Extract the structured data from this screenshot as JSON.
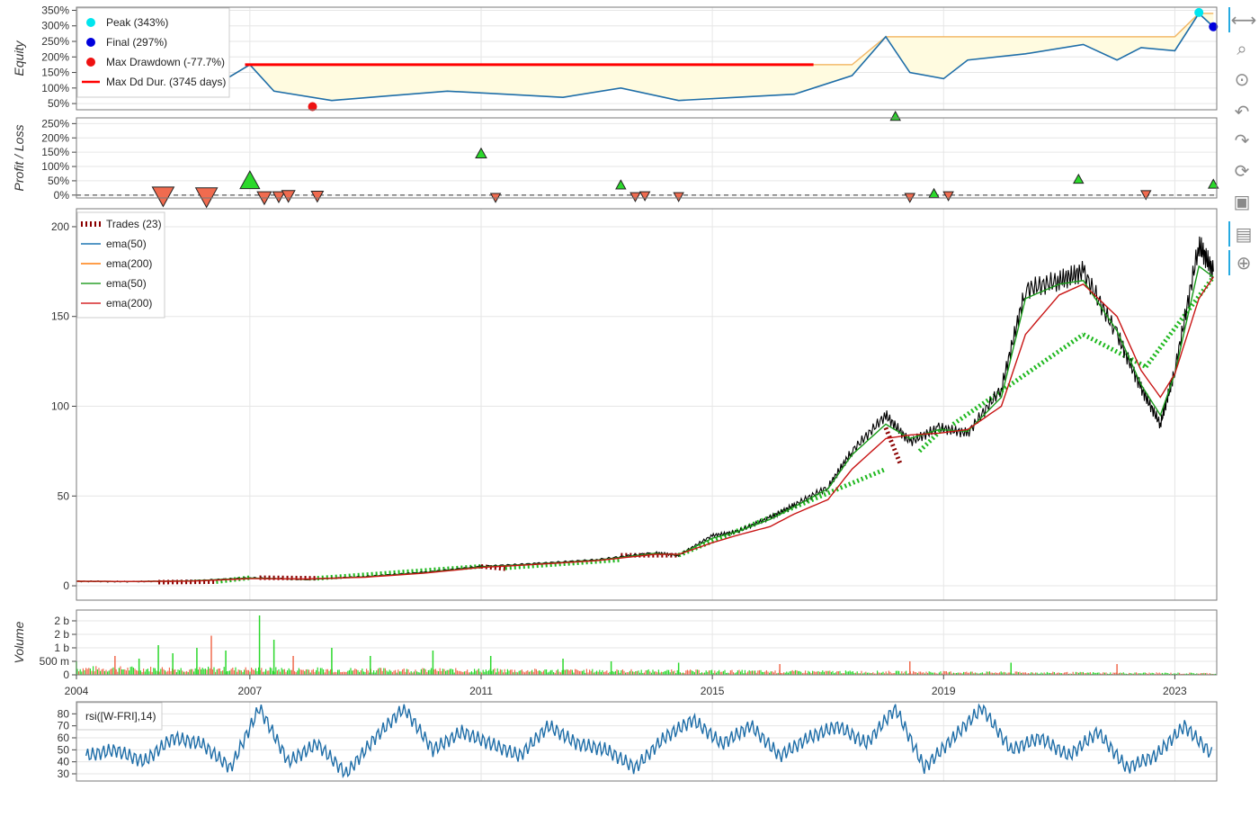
{
  "colors": {
    "equity_line": "#1f6ea8",
    "drawdown_fill": "#fffbe0",
    "peak_line": "#f2b96a",
    "max_dd_line": "#ff0000",
    "peak_marker": "#00e5ee",
    "final_marker": "#0000dd",
    "dd_marker": "#ee1111",
    "win": "#2bd82b",
    "loss": "#f06b4f",
    "price": "#000000",
    "ema50_main": "#1a9a1a",
    "ema200_main": "#c81414",
    "trades_loss": "#8b0000",
    "rsi": "#1f6ea8",
    "grid": "#e6e6e6"
  },
  "chart_data": [
    {
      "type": "line",
      "panel": "equity",
      "ylabel": "Equity",
      "y_ticks": [
        "50%",
        "100%",
        "150%",
        "200%",
        "250%",
        "300%",
        "350%"
      ],
      "ylim": [
        30,
        360
      ],
      "x": [
        "2004-01",
        "2004-06",
        "2005-06",
        "2006-06",
        "2007-01",
        "2007-06",
        "2008-06",
        "2009-06",
        "2010-06",
        "2011-06",
        "2012-06",
        "2013-06",
        "2014-06",
        "2015-06",
        "2016-06",
        "2017-06",
        "2018-01",
        "2018-06",
        "2019-01",
        "2019-06",
        "2020-06",
        "2021-06",
        "2022-01",
        "2022-06",
        "2023-01",
        "2023-06",
        "2023-09"
      ],
      "values": [
        100,
        100,
        110,
        110,
        175,
        90,
        60,
        75,
        90,
        80,
        70,
        100,
        60,
        70,
        80,
        140,
        265,
        150,
        130,
        190,
        210,
        240,
        190,
        230,
        220,
        340,
        297
      ],
      "legend": [
        {
          "label": "Peak (343%)",
          "marker": "circle",
          "color": "#00e5ee"
        },
        {
          "label": "Final (297%)",
          "marker": "circle",
          "color": "#0000dd"
        },
        {
          "label": "Max Drawdown (-77.7%)",
          "marker": "circle",
          "color": "#ee1111"
        },
        {
          "label": "Max Dd Dur. (3745 days)",
          "marker": "line",
          "color": "#ff0000"
        }
      ],
      "peak": {
        "x": "2023-06",
        "value": 343
      },
      "final": {
        "x": "2023-09",
        "value": 297
      },
      "max_drawdown": {
        "x": "2008-02",
        "value": 40
      },
      "max_dd_duration": {
        "x_start": "2006-12",
        "x_end": "2016-10",
        "value": 175
      }
    },
    {
      "type": "scatter",
      "panel": "profit_loss",
      "ylabel": "Profit / Loss",
      "y_ticks": [
        "0%",
        "50%",
        "100%",
        "150%",
        "200%",
        "250%"
      ],
      "ylim": [
        -10,
        270
      ],
      "points": [
        {
          "x": "2005-07",
          "value": -2,
          "size": 2.0,
          "result": "loss"
        },
        {
          "x": "2006-04",
          "value": -5,
          "size": 2.0,
          "result": "loss"
        },
        {
          "x": "2007-01",
          "value": 50,
          "size": 1.8,
          "result": "win"
        },
        {
          "x": "2007-04",
          "value": -8,
          "size": 1.3,
          "result": "loss"
        },
        {
          "x": "2007-07",
          "value": -5,
          "size": 1.1,
          "result": "loss"
        },
        {
          "x": "2007-09",
          "value": -2,
          "size": 1.2,
          "result": "loss"
        },
        {
          "x": "2008-03",
          "value": -3,
          "size": 1.1,
          "result": "loss"
        },
        {
          "x": "2011-01",
          "value": 145,
          "size": 1.0,
          "result": "win"
        },
        {
          "x": "2011-04",
          "value": -8,
          "size": 0.9,
          "result": "loss"
        },
        {
          "x": "2013-06",
          "value": 35,
          "size": 0.9,
          "result": "win"
        },
        {
          "x": "2013-09",
          "value": -5,
          "size": 0.9,
          "result": "loss"
        },
        {
          "x": "2013-11",
          "value": -2,
          "size": 0.9,
          "result": "loss"
        },
        {
          "x": "2014-06",
          "value": -5,
          "size": 0.9,
          "result": "loss"
        },
        {
          "x": "2018-03",
          "value": 275,
          "size": 0.9,
          "result": "win"
        },
        {
          "x": "2018-06",
          "value": -8,
          "size": 0.9,
          "result": "loss"
        },
        {
          "x": "2018-11",
          "value": 5,
          "size": 0.9,
          "result": "win"
        },
        {
          "x": "2019-02",
          "value": -2,
          "size": 0.9,
          "result": "loss"
        },
        {
          "x": "2021-05",
          "value": 55,
          "size": 0.9,
          "result": "win"
        },
        {
          "x": "2022-07",
          "value": 2,
          "size": 0.9,
          "result": "loss"
        },
        {
          "x": "2023-09",
          "value": 38,
          "size": 0.9,
          "result": "win"
        }
      ]
    },
    {
      "type": "line",
      "panel": "price",
      "y_ticks": [
        "0",
        "50",
        "100",
        "150",
        "200"
      ],
      "ylim": [
        -8,
        210
      ],
      "x": [
        "2004-01",
        "2005-01",
        "2006-01",
        "2007-01",
        "2008-01",
        "2009-01",
        "2010-01",
        "2011-01",
        "2012-01",
        "2013-01",
        "2014-01",
        "2014-06",
        "2015-01",
        "2015-06",
        "2016-01",
        "2016-06",
        "2017-01",
        "2017-06",
        "2018-01",
        "2018-06",
        "2018-12",
        "2019-06",
        "2020-01",
        "2020-06",
        "2021-01",
        "2021-06",
        "2022-01",
        "2022-06",
        "2022-10",
        "2023-01",
        "2023-06",
        "2023-09"
      ],
      "series": [
        {
          "values": [
            2.5,
            2.3,
            2.8,
            4.5,
            3.5,
            5.2,
            7.5,
            10.8,
            12.5,
            14.5,
            18.5,
            17,
            28,
            30,
            38,
            45,
            55,
            75,
            95,
            80,
            88,
            85,
            110,
            165,
            170,
            175,
            140,
            110,
            90,
            120,
            190,
            175
          ]
        },
        {
          "name": "ema(50)",
          "values": [
            2.5,
            2.4,
            2.7,
            4.3,
            3.6,
            5.0,
            7.2,
            10.5,
            12.2,
            14.2,
            18.0,
            17.2,
            26.5,
            30,
            37,
            44,
            54,
            73,
            90,
            82,
            87,
            86,
            105,
            160,
            168,
            170,
            142,
            112,
            95,
            118,
            178,
            172
          ]
        },
        {
          "name": "ema(200)",
          "values": [
            2.5,
            2.4,
            2.6,
            4.0,
            3.8,
            4.8,
            7.0,
            10.2,
            12.0,
            14.0,
            17.5,
            17.5,
            24,
            28,
            33,
            40,
            48,
            65,
            82,
            84,
            85,
            87,
            100,
            140,
            162,
            168,
            150,
            120,
            105,
            118,
            160,
            172
          ]
        }
      ],
      "legend": [
        {
          "label": "Trades (23)",
          "style": "dashed",
          "color": "#8b0000"
        },
        {
          "label": "ema(50)",
          "style": "line",
          "color": "#1f77b4"
        },
        {
          "label": "ema(200)",
          "style": "line",
          "color": "#ff7f0e"
        },
        {
          "label": "ema(50)",
          "style": "line",
          "color": "#2ca02c"
        },
        {
          "label": "ema(200)",
          "style": "line",
          "color": "#d62728"
        }
      ],
      "trades": [
        {
          "x1": "2005-06",
          "y1": 2.0,
          "x2": "2006-06",
          "y2": 2.3,
          "result": "loss"
        },
        {
          "x1": "2006-06",
          "y1": 2.3,
          "x2": "2007-01",
          "y2": 4.5,
          "result": "win"
        },
        {
          "x1": "2007-03",
          "y1": 4.5,
          "x2": "2008-03",
          "y2": 4.2,
          "result": "loss"
        },
        {
          "x1": "2008-03",
          "y1": 4.2,
          "x2": "2011-01",
          "y2": 10.8,
          "result": "win"
        },
        {
          "x1": "2011-01",
          "y1": 10.8,
          "x2": "2011-06",
          "y2": 9.5,
          "result": "loss"
        },
        {
          "x1": "2011-06",
          "y1": 10,
          "x2": "2013-06",
          "y2": 14.5,
          "result": "win"
        },
        {
          "x1": "2013-06",
          "y1": 17,
          "x2": "2014-06",
          "y2": 17,
          "result": "loss"
        },
        {
          "x1": "2014-06",
          "y1": 17,
          "x2": "2018-01",
          "y2": 65,
          "result": "win"
        },
        {
          "x1": "2018-01",
          "y1": 88,
          "x2": "2018-04",
          "y2": 68,
          "result": "loss"
        },
        {
          "x1": "2018-08",
          "y1": 75,
          "x2": "2019-01",
          "y2": 88,
          "result": "win"
        },
        {
          "x1": "2019-03",
          "y1": 90,
          "x2": "2021-06",
          "y2": 140,
          "result": "win"
        },
        {
          "x1": "2021-06",
          "y1": 140,
          "x2": "2022-07",
          "y2": 122,
          "result": "win"
        },
        {
          "x1": "2022-07",
          "y1": 122,
          "x2": "2023-09",
          "y2": 172,
          "result": "win"
        }
      ]
    },
    {
      "type": "bar",
      "panel": "volume",
      "ylabel": "Volume",
      "y_ticks": [
        "0",
        "500 m",
        "1 b",
        "2 b",
        "2 b"
      ],
      "ylim": [
        0,
        2400
      ],
      "spikes": [
        {
          "x": "2004-01",
          "value": 500,
          "result": "win"
        },
        {
          "x": "2004-09",
          "value": 700,
          "result": "loss"
        },
        {
          "x": "2005-02",
          "value": 600,
          "result": "win"
        },
        {
          "x": "2005-06",
          "value": 1100,
          "result": "win"
        },
        {
          "x": "2005-09",
          "value": 800,
          "result": "win"
        },
        {
          "x": "2006-02",
          "value": 1000,
          "result": "win"
        },
        {
          "x": "2006-05",
          "value": 1450,
          "result": "loss"
        },
        {
          "x": "2006-08",
          "value": 900,
          "result": "win"
        },
        {
          "x": "2007-03",
          "value": 2200,
          "result": "win"
        },
        {
          "x": "2007-06",
          "value": 1300,
          "result": "win"
        },
        {
          "x": "2007-10",
          "value": 700,
          "result": "loss"
        },
        {
          "x": "2008-06",
          "value": 1000,
          "result": "win"
        },
        {
          "x": "2009-02",
          "value": 700,
          "result": "win"
        },
        {
          "x": "2010-03",
          "value": 900,
          "result": "win"
        },
        {
          "x": "2011-03",
          "value": 700,
          "result": "win"
        },
        {
          "x": "2012-06",
          "value": 600,
          "result": "win"
        },
        {
          "x": "2013-04",
          "value": 500,
          "result": "win"
        },
        {
          "x": "2014-06",
          "value": 450,
          "result": "win"
        },
        {
          "x": "2016-03",
          "value": 400,
          "result": "loss"
        },
        {
          "x": "2018-06",
          "value": 500,
          "result": "loss"
        },
        {
          "x": "2020-03",
          "value": 450,
          "result": "win"
        },
        {
          "x": "2022-01",
          "value": 400,
          "result": "loss"
        }
      ]
    },
    {
      "type": "line",
      "panel": "rsi",
      "y_ticks": [
        "30",
        "40",
        "50",
        "60",
        "70",
        "80"
      ],
      "ylim": [
        24,
        90
      ],
      "legend": [
        {
          "label": "rsi([W-FRI],14)",
          "style": "line",
          "color": "#1f6ea8"
        }
      ],
      "x": [
        "2004-03",
        "2004-09",
        "2005-03",
        "2005-09",
        "2006-03",
        "2006-09",
        "2007-03",
        "2007-09",
        "2008-03",
        "2008-09",
        "2009-03",
        "2009-09",
        "2010-03",
        "2010-09",
        "2011-03",
        "2011-09",
        "2012-03",
        "2012-09",
        "2013-03",
        "2013-09",
        "2014-03",
        "2014-09",
        "2015-03",
        "2015-09",
        "2016-03",
        "2016-09",
        "2017-03",
        "2017-09",
        "2018-03",
        "2018-09",
        "2019-03",
        "2019-09",
        "2020-03",
        "2020-09",
        "2021-03",
        "2021-09",
        "2022-03",
        "2022-09",
        "2023-03",
        "2023-09"
      ],
      "values": [
        45,
        50,
        40,
        60,
        55,
        35,
        85,
        40,
        55,
        30,
        60,
        85,
        50,
        65,
        55,
        45,
        70,
        55,
        50,
        35,
        60,
        75,
        55,
        70,
        45,
        60,
        70,
        55,
        85,
        35,
        60,
        85,
        50,
        60,
        45,
        65,
        35,
        45,
        70,
        45
      ]
    }
  ],
  "x_axis": {
    "tick_labels": [
      "2004",
      "2007",
      "2011",
      "2015",
      "2019",
      "2023"
    ],
    "tick_values": [
      "2004-01",
      "2007-01",
      "2011-01",
      "2015-01",
      "2019-01",
      "2023-01"
    ]
  },
  "toolbar": [
    {
      "icon": "pan-icon",
      "glyph": "⟷"
    },
    {
      "icon": "box-zoom-icon",
      "glyph": "⌕"
    },
    {
      "icon": "wheel-zoom-icon",
      "glyph": "⊙"
    },
    {
      "icon": "undo-icon",
      "glyph": "↶"
    },
    {
      "icon": "redo-icon",
      "glyph": "↷"
    },
    {
      "icon": "reset-icon",
      "glyph": "⟳"
    },
    {
      "icon": "save-icon",
      "glyph": "▣"
    },
    {
      "icon": "hover-icon",
      "glyph": "▤"
    },
    {
      "icon": "crosshair-icon",
      "glyph": "⊕"
    }
  ]
}
